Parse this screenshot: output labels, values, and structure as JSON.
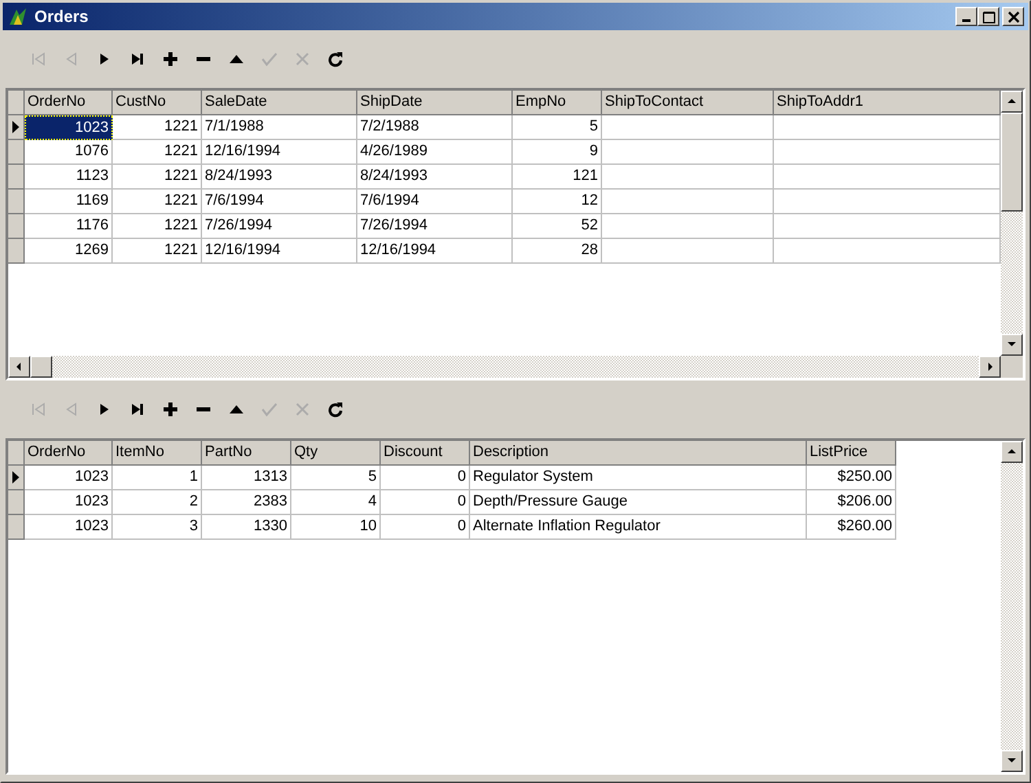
{
  "window": {
    "title": "Orders"
  },
  "panels": [
    {
      "navigator": [
        {
          "kind": "first",
          "disabled": true
        },
        {
          "kind": "prior",
          "disabled": true
        },
        {
          "kind": "next",
          "disabled": false
        },
        {
          "kind": "last",
          "disabled": false
        },
        {
          "kind": "insert",
          "disabled": false
        },
        {
          "kind": "delete",
          "disabled": false
        },
        {
          "kind": "edit",
          "disabled": false
        },
        {
          "kind": "post",
          "disabled": true
        },
        {
          "kind": "cancel",
          "disabled": true
        },
        {
          "kind": "refresh",
          "disabled": false
        }
      ],
      "grid": {
        "focused": true,
        "columns": [
          {
            "label": "OrderNo",
            "kind": "number"
          },
          {
            "label": "CustNo",
            "kind": "number"
          },
          {
            "label": "SaleDate",
            "kind": "text"
          },
          {
            "label": "ShipDate",
            "kind": "text"
          },
          {
            "label": "EmpNo",
            "kind": "number"
          },
          {
            "label": "ShipToContact",
            "kind": "text"
          },
          {
            "label": "ShipToAddr1",
            "kind": "text"
          }
        ],
        "rows": [
          {
            "selected": true,
            "cells": [
              "1023",
              "1221",
              "7/1/1988",
              "7/2/1988",
              "5",
              "",
              ""
            ]
          },
          {
            "selected": false,
            "cells": [
              "1076",
              "1221",
              "12/16/1994",
              "4/26/1989",
              "9",
              "",
              ""
            ]
          },
          {
            "selected": false,
            "cells": [
              "1123",
              "1221",
              "8/24/1993",
              "8/24/1993",
              "121",
              "",
              ""
            ]
          },
          {
            "selected": false,
            "cells": [
              "1169",
              "1221",
              "7/6/1994",
              "7/6/1994",
              "12",
              "",
              ""
            ]
          },
          {
            "selected": false,
            "cells": [
              "1176",
              "1221",
              "7/26/1994",
              "7/26/1994",
              "52",
              "",
              ""
            ]
          },
          {
            "selected": false,
            "cells": [
              "1269",
              "1221",
              "12/16/1994",
              "12/16/1994",
              "28",
              "",
              ""
            ]
          }
        ]
      }
    },
    {
      "navigator": [
        {
          "kind": "first",
          "disabled": true
        },
        {
          "kind": "prior",
          "disabled": true
        },
        {
          "kind": "next",
          "disabled": false
        },
        {
          "kind": "last",
          "disabled": false
        },
        {
          "kind": "insert",
          "disabled": false
        },
        {
          "kind": "delete",
          "disabled": false
        },
        {
          "kind": "edit",
          "disabled": false
        },
        {
          "kind": "post",
          "disabled": true
        },
        {
          "kind": "cancel",
          "disabled": true
        },
        {
          "kind": "refresh",
          "disabled": false
        }
      ],
      "grid": {
        "focused": false,
        "columns": [
          {
            "label": "OrderNo",
            "kind": "number"
          },
          {
            "label": "ItemNo",
            "kind": "number"
          },
          {
            "label": "PartNo",
            "kind": "number"
          },
          {
            "label": "Qty",
            "kind": "number"
          },
          {
            "label": "Discount",
            "kind": "number"
          },
          {
            "label": "Description",
            "kind": "text"
          },
          {
            "label": "ListPrice",
            "kind": "number"
          }
        ],
        "rows": [
          {
            "selected": true,
            "cells": [
              "1023",
              "1",
              "1313",
              "5",
              "0",
              "Regulator System",
              "$250.00"
            ]
          },
          {
            "selected": false,
            "cells": [
              "1023",
              "2",
              "2383",
              "4",
              "0",
              "Depth/Pressure Gauge",
              "$206.00"
            ]
          },
          {
            "selected": false,
            "cells": [
              "1023",
              "3",
              "1330",
              "10",
              "0",
              "Alternate Inflation Regulator",
              "$260.00"
            ]
          }
        ]
      }
    }
  ]
}
